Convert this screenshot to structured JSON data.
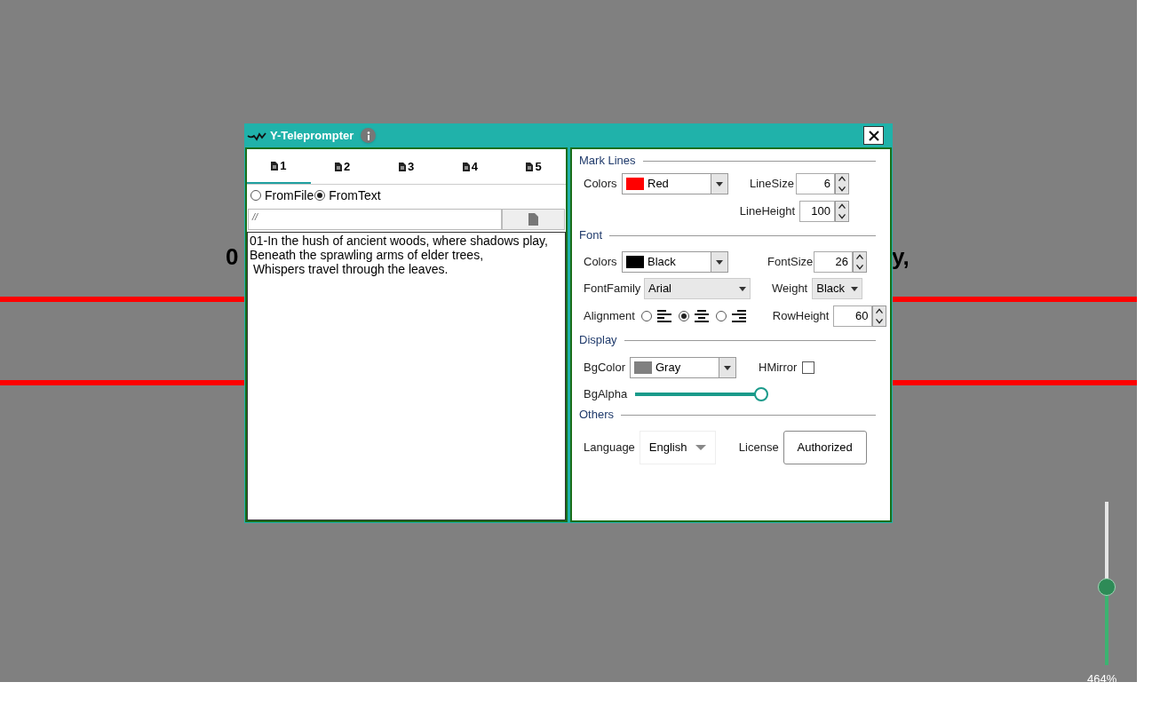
{
  "prompter": {
    "left_fragment": "0",
    "right_fragment": "y,"
  },
  "zoom": {
    "level": 0.48,
    "reading": "464%"
  },
  "window": {
    "title": "Y-Teleprompter"
  },
  "tabs": [
    {
      "label": "1",
      "selected": true
    },
    {
      "label": "2",
      "selected": false
    },
    {
      "label": "3",
      "selected": false
    },
    {
      "label": "4",
      "selected": false
    },
    {
      "label": "5",
      "selected": false
    }
  ],
  "source": [
    {
      "label": "FromFile",
      "selected": false
    },
    {
      "label": "FromText",
      "selected": true
    }
  ],
  "path_field": {
    "value": "//"
  },
  "script_text": "01-In the hush of ancient woods, where shadows play,\nBeneath the sprawling arms of elder trees,\n Whispers travel through the leaves.",
  "mark_lines": {
    "title": "Mark Lines",
    "colors": {
      "label": "Colors",
      "value": "Red",
      "color": "#ff0000"
    },
    "line_size": {
      "label": "LineSize",
      "value": "6"
    },
    "line_height": {
      "label": "LineHeight",
      "value": "100"
    }
  },
  "font": {
    "title": "Font",
    "colors": {
      "label": "Colors",
      "value": "Black",
      "color": "#000000"
    },
    "font_size": {
      "label": "FontSize",
      "value": "26"
    },
    "font_family": {
      "label": "FontFamily",
      "value": "Arial"
    },
    "weight": {
      "label": "Weight",
      "value": "Black"
    },
    "alignment": {
      "label": "Alignment",
      "options": [
        {
          "kind": "left",
          "selected": false
        },
        {
          "kind": "center",
          "selected": true
        },
        {
          "kind": "right",
          "selected": false
        }
      ]
    },
    "row_height": {
      "label": "RowHeight",
      "value": "60"
    }
  },
  "display": {
    "title": "Display",
    "bg_color": {
      "label": "BgColor",
      "value": "Gray",
      "color": "#808080"
    },
    "hmirror": {
      "label": "HMirror",
      "checked": false
    },
    "bg_alpha": {
      "label": "BgAlpha",
      "level": 1
    }
  },
  "others": {
    "title": "Others",
    "language": {
      "label": "Language",
      "value": "English"
    },
    "license": {
      "label": "License",
      "button": "Authorized"
    }
  }
}
